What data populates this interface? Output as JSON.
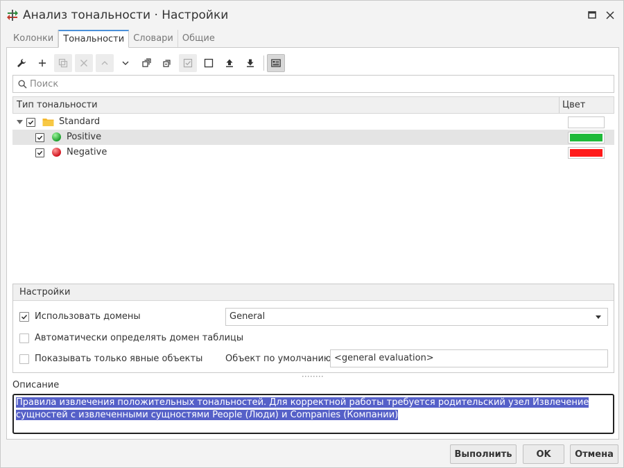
{
  "window": {
    "title": "Анализ тональности · Настройки"
  },
  "tabs": [
    {
      "label": "Колонки",
      "active": false
    },
    {
      "label": "Тональности",
      "active": true
    },
    {
      "label": "Словари",
      "active": false
    },
    {
      "label": "Общие",
      "active": false
    }
  ],
  "toolbar": {
    "icons": [
      "wrench-icon",
      "plus-icon",
      "copy-icon",
      "delete-icon",
      "arrow-up-icon",
      "arrow-down-icon",
      "expand-all-icon",
      "collapse-all-icon",
      "check-all-icon",
      "uncheck-all-icon",
      "import-icon",
      "export-icon",
      "details-icon"
    ]
  },
  "search": {
    "placeholder": "Поиск",
    "value": ""
  },
  "grid": {
    "columns": {
      "type": "Тип тональности",
      "color": "Цвет"
    },
    "rows": [
      {
        "label": "Standard",
        "level": 0,
        "checked": true,
        "icon": "folder-icon",
        "color": "#ffffff",
        "selected": false
      },
      {
        "label": "Positive",
        "level": 1,
        "checked": true,
        "icon": "green-circle-icon",
        "color": "#1fba3a",
        "selected": true
      },
      {
        "label": "Negative",
        "level": 1,
        "checked": true,
        "icon": "red-circle-icon",
        "color": "#ff1a1a",
        "selected": false
      }
    ]
  },
  "settings": {
    "title": "Настройки",
    "use_domains": {
      "label": "Использовать домены",
      "checked": true
    },
    "domain": {
      "value": "General"
    },
    "auto_detect": {
      "label": "Автоматически определять домен таблицы",
      "checked": false
    },
    "explicit_only": {
      "label": "Показывать только явные объекты",
      "checked": false
    },
    "default_object": {
      "label": "Объект по умолчанию",
      "value": "<general evaluation>"
    }
  },
  "description": {
    "label": "Описание",
    "text": "Правила извлечения положительных тональностей. Для корректной работы требуется родительский узел Извлечение сущностей с извлеченными сущностями People (Люди) и Companies (Компании)"
  },
  "buttons": {
    "run": "Выполнить",
    "ok": "OK",
    "cancel": "Отмена"
  },
  "colors": {
    "accent": "#4a90d9",
    "selection": "#5560c8"
  }
}
